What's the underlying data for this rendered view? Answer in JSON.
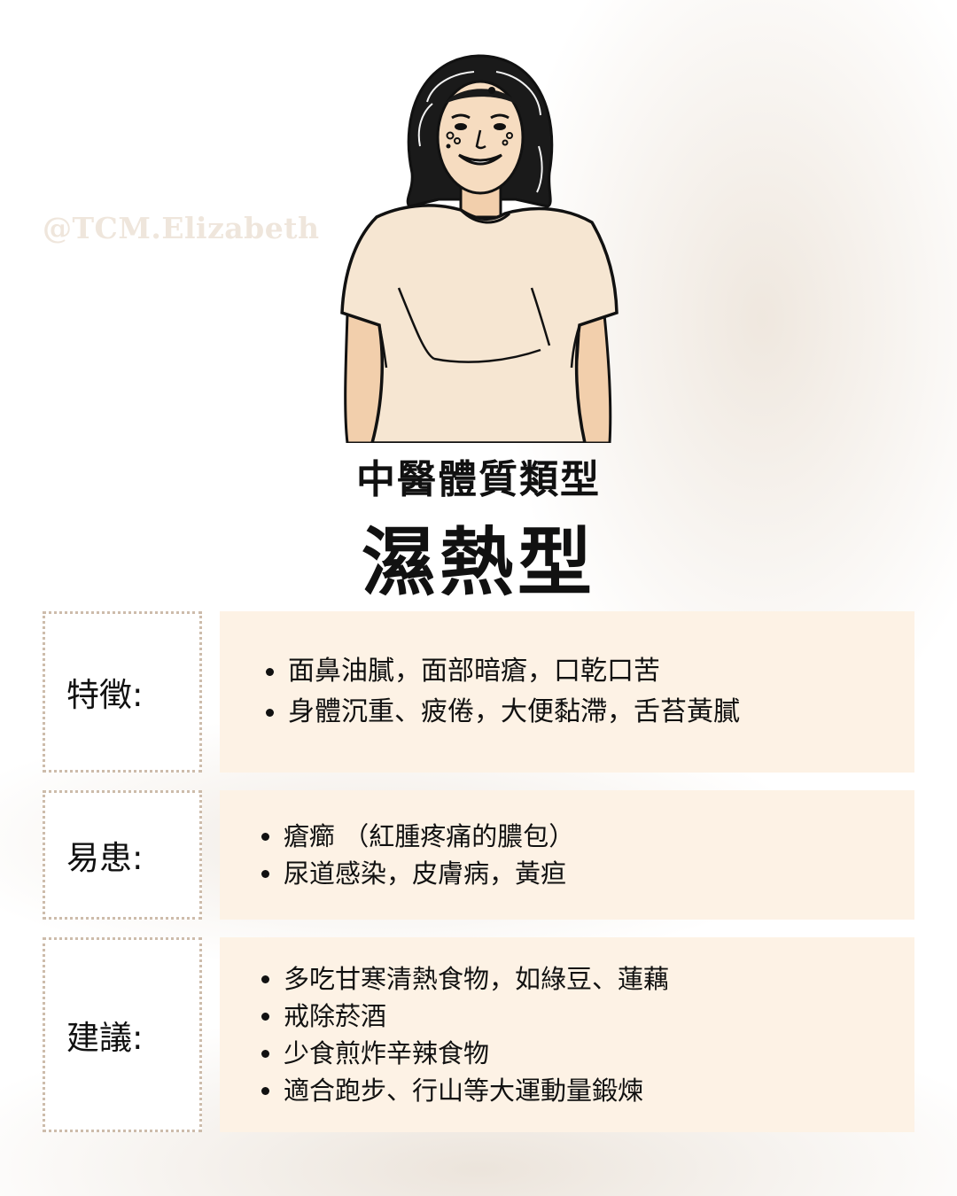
{
  "watermark": "@TCM.Elizabeth",
  "header": {
    "subtitle": "中醫體質類型",
    "title": "濕熱型"
  },
  "sections": [
    {
      "label": "特徵:",
      "items": [
        "面鼻油膩，面部暗瘡，口乾口苦",
        "身體沉重、疲倦，大便黏滯，舌苔黃膩"
      ]
    },
    {
      "label": "易患:",
      "items": [
        "瘡癤 （紅腫疼痛的膿包）",
        "尿道感染，皮膚病，黃疸"
      ]
    },
    {
      "label": "建議:",
      "items": [
        "多吃甘寒清熱食物，如綠豆、蓮藕",
        "戒除菸酒",
        "少食煎炸辛辣食物",
        "適合跑步、行山等大運動量鍛煉"
      ]
    }
  ],
  "colors": {
    "content_bg": "#fdf2e5",
    "label_border": "#cdbcab",
    "skin": "#f6dcc0",
    "shirt": "#f6e6d2",
    "text": "#111111"
  },
  "icons": {
    "figure": "woman-illustration"
  }
}
